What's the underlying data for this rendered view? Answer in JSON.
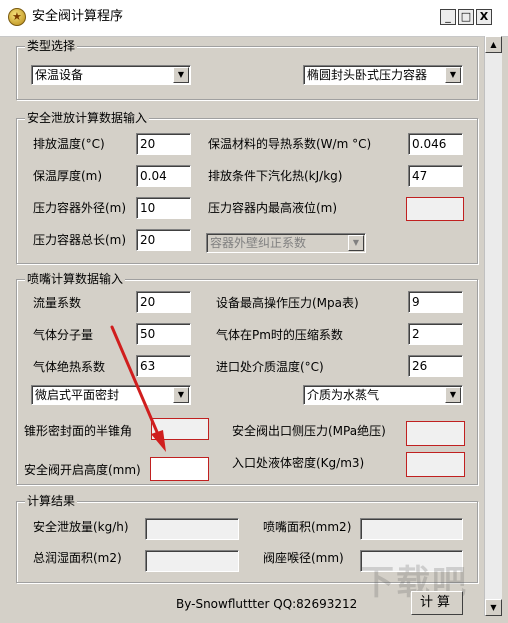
{
  "window": {
    "title": "安全阀计算程序",
    "min_glyph": "_",
    "max_glyph": "□",
    "close_glyph": "X"
  },
  "type_select": {
    "title": "类型选择",
    "left_value": "保温设备",
    "right_value": "椭圆封头卧式压力容器"
  },
  "relief": {
    "title": "安全泄放计算数据输入",
    "fields": [
      {
        "label": "排放温度(°C)",
        "value": "20"
      },
      {
        "label": "保温厚度(m)",
        "value": "0.04"
      },
      {
        "label": "压力容器外径(m)",
        "value": "10"
      },
      {
        "label": "压力容器总长(m)",
        "value": "20"
      },
      {
        "label": "保温材料的导热系数(W/m °C)",
        "value": "0.046"
      },
      {
        "label": "排放条件下汽化热(kJ/kg)",
        "value": "47"
      },
      {
        "label": "压力容器内最高液位(m)",
        "value": ""
      }
    ],
    "correction_select": "容器外壁纠正系数"
  },
  "nozzle": {
    "title": "喷嘴计算数据输入",
    "fields": [
      {
        "label": "流量系数",
        "value": "20"
      },
      {
        "label": "气体分子量",
        "value": "50"
      },
      {
        "label": "气体绝热系数",
        "value": "63"
      },
      {
        "label": "设备最高操作压力(Mpa表)",
        "value": "9"
      },
      {
        "label": "气体在Pm时的压缩系数",
        "value": "2"
      },
      {
        "label": "进口处介质温度(°C)",
        "value": "26"
      }
    ],
    "seal_select": "微启式平面密封",
    "medium_select": "介质为水蒸气",
    "extra_fields": [
      {
        "label": "锥形密封面的半锥角",
        "value": ""
      },
      {
        "label": "安全阀开启高度(mm)",
        "value": ""
      },
      {
        "label": "安全阀出口侧压力(MPa绝压)",
        "value": ""
      },
      {
        "label": "入口处液体密度(Kg/m3)",
        "value": ""
      }
    ]
  },
  "results": {
    "title": "计算结果",
    "fields": [
      {
        "label": "安全泄放量(kg/h)",
        "value": ""
      },
      {
        "label": "总润湿面积(m2)",
        "value": ""
      },
      {
        "label": "喷嘴面积(mm2)",
        "value": ""
      },
      {
        "label": "阀座喉径(mm)",
        "value": ""
      }
    ]
  },
  "footer": {
    "credit": "By-Snowfluttter  QQ:82693212",
    "calc_label": "计算"
  },
  "watermark": {
    "text": "下载吧"
  },
  "colors": {
    "arrow": "#d01e1e",
    "highlight_border": "#c02020"
  }
}
